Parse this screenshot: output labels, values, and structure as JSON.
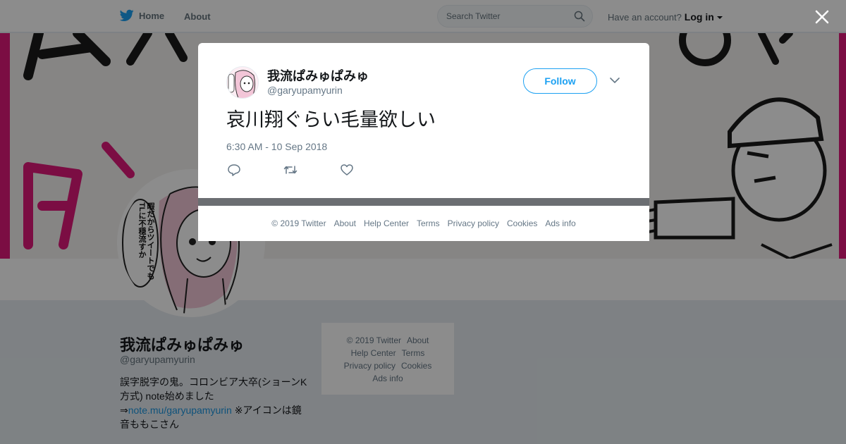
{
  "nav": {
    "home_label": "Home",
    "about_label": "About",
    "search_placeholder": "Search Twitter",
    "have_account": "Have an account?",
    "login_label": "Log in"
  },
  "profile": {
    "name": "我流ぱみゅぱみゅ",
    "handle": "@garyupamyurin",
    "bio_part1": "誤字脱字の鬼。コロンビア大卒(ショーンK方式) note始めました ⇒",
    "bio_link": "note.mu/garyupamyurin",
    "bio_part2": " ※アイコンは鏡音ももこさん",
    "avatar_speech": "暇だからツイートでもTLに不穏流すか"
  },
  "side_footer": {
    "copyright": "© 2019 Twitter",
    "about": "About",
    "help": "Help Center",
    "terms": "Terms",
    "privacy": "Privacy policy",
    "cookies": "Cookies",
    "ads": "Ads info"
  },
  "tweet": {
    "name": "我流ぱみゅぱみゅ",
    "handle": "@garyupamyurin",
    "follow_label": "Follow",
    "text": "哀川翔ぐらい毛量欲しい",
    "timestamp": "6:30 AM - 10 Sep 2018"
  },
  "modal_footer": {
    "copyright": "© 2019 Twitter",
    "about": "About",
    "help": "Help Center",
    "terms": "Terms",
    "privacy": "Privacy policy",
    "cookies": "Cookies",
    "ads": "Ads info"
  },
  "colors": {
    "brand": "#1da1f2",
    "banner_pink": "#e0197a",
    "overlay": "rgba(0,0,0,0.45)"
  }
}
